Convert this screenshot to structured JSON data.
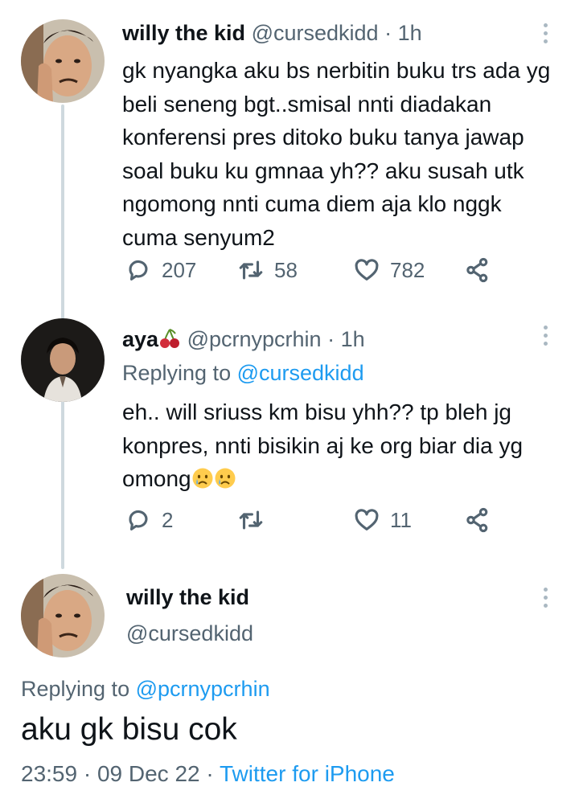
{
  "tweets": [
    {
      "display_name": "willy the kid",
      "handle": "@cursedkidd",
      "separator": "·",
      "time": "1h",
      "text": "gk nyangka aku bs nerbitin buku trs ada yg beli seneng bgt..smisal nnti diadakan konferensi pres ditoko buku tanya jawap soal buku ku gmnaa yh?? aku susah utk ngomong nnti cuma diem aja klo nggk cuma senyum2",
      "replies": "207",
      "retweets": "58",
      "likes": "782",
      "avatar": "avatar-man"
    },
    {
      "display_name": "aya",
      "name_emoji": "cherries-emoji",
      "handle": "@pcrnypcrhin",
      "separator": "·",
      "time": "1h",
      "replying_label": "Replying to",
      "replying_to": "@cursedkidd",
      "text": "eh.. will sriuss km bisu yhh?? tp bleh jg konpres, nnti bisikin aj ke org biar dia yg omong",
      "text_emojis": [
        "crying-face-emoji",
        "crying-face-emoji"
      ],
      "replies": "2",
      "retweets": "",
      "likes": "11",
      "avatar": "avatar-woman"
    }
  ],
  "main_tweet": {
    "display_name": "willy the kid",
    "handle": "@cursedkidd",
    "replying_label": "Replying to",
    "replying_to": "@pcrnypcrhin",
    "text": "aku gk bisu cok",
    "time": "23:59",
    "separator1": "·",
    "date": "09 Dec 22",
    "separator2": "·",
    "source": "Twitter for iPhone"
  },
  "icons": [
    "reply-icon",
    "retweet-icon",
    "like-icon",
    "share-icon",
    "more-options-icon"
  ],
  "colors": {
    "text": "#0f1419",
    "secondary": "#536471",
    "link": "#1d9bf0",
    "thread_line": "#cfd9de",
    "background": "#ffffff"
  }
}
